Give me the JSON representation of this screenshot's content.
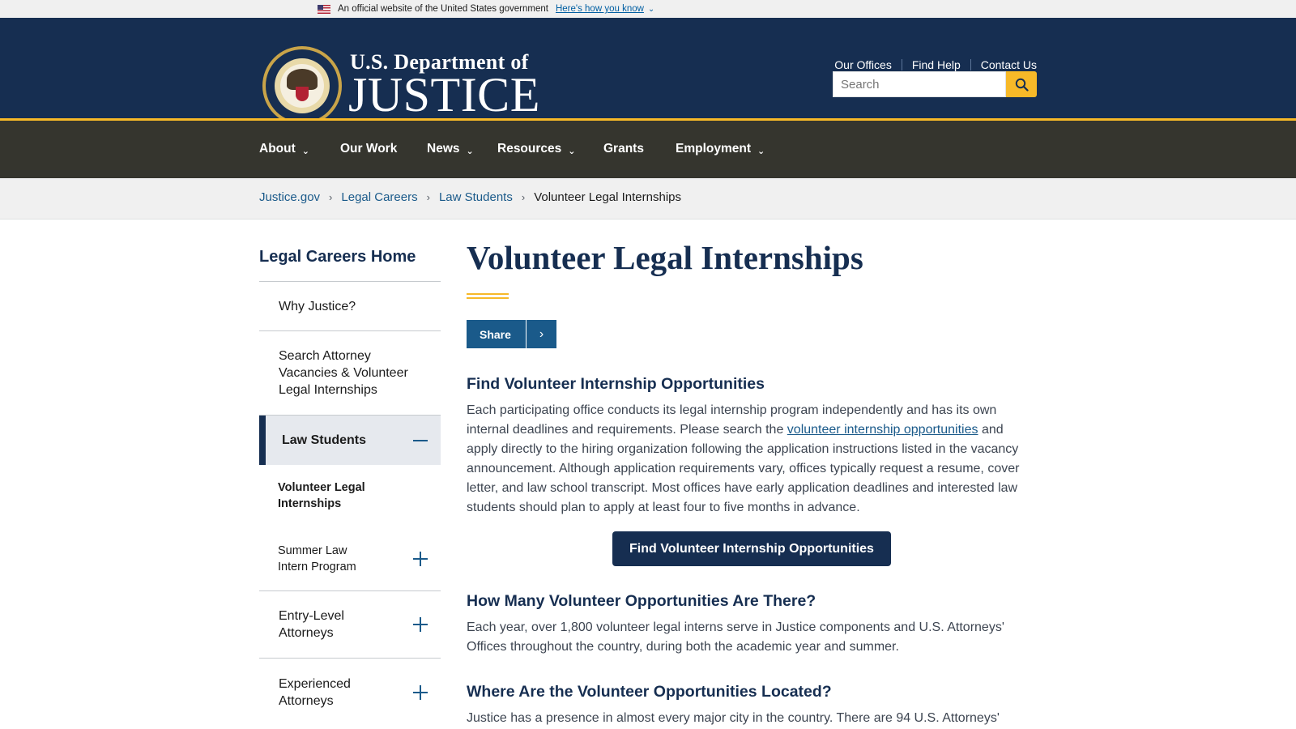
{
  "gov_banner": {
    "text": "An official website of the United States government",
    "link": "Here's how you know"
  },
  "header": {
    "logo_top": "U.S. Department of",
    "logo_main": "JUSTICE",
    "utility_nav": [
      "Our Offices",
      "Find Help",
      "Contact Us"
    ],
    "search_placeholder": "Search"
  },
  "main_nav": [
    {
      "label": "About",
      "has_dropdown": true
    },
    {
      "label": "Our Work",
      "has_dropdown": false
    },
    {
      "label": "News",
      "has_dropdown": true
    },
    {
      "label": "Resources",
      "has_dropdown": true
    },
    {
      "label": "Grants",
      "has_dropdown": false
    },
    {
      "label": "Employment",
      "has_dropdown": true
    }
  ],
  "breadcrumb": {
    "links": [
      "Justice.gov",
      "Legal Careers",
      "Law Students"
    ],
    "current": "Volunteer Legal Internships"
  },
  "sidebar": {
    "title": "Legal Careers Home",
    "items": [
      "Why Justice?",
      "Search Attorney Vacancies & Volunteer Legal Internships",
      "Law Students",
      "Entry-Level Attorneys",
      "Experienced Attorneys"
    ],
    "sub_items": [
      "Volunteer Legal Internships",
      "Summer Law Intern Program"
    ]
  },
  "content": {
    "title": "Volunteer Legal Internships",
    "share_label": "Share",
    "section1": {
      "heading": "Find Volunteer Internship Opportunities",
      "text_before_link": "Each participating office conducts its legal internship program independently and has its own internal deadlines and requirements. Please search the ",
      "link_text": "volunteer internship opportunities",
      "text_after_link": " and apply directly to the hiring organization following the application instructions listed in the vacancy announcement. Although application requirements vary, offices typically request a resume, cover letter, and law school transcript. Most offices have early application deadlines and interested law students should plan to apply at least four to five months in advance.",
      "button": "Find Volunteer Internship Opportunities"
    },
    "section2": {
      "heading": "How Many Volunteer Opportunities Are There?",
      "text": "Each year, over 1,800 volunteer legal interns serve in Justice components and U.S. Attorneys' Offices throughout the country, during both the academic year and summer."
    },
    "section3": {
      "heading": "Where Are the Volunteer Opportunities Located?",
      "text": "Justice has a presence in almost every major city in the country. There are 94 U.S. Attorneys'"
    }
  },
  "colors": {
    "navy": "#162e51",
    "gold": "#f7b928",
    "nav_bg": "#35352e",
    "link": "#1a5a8a"
  },
  "icons": {
    "flag": "us-flag-icon",
    "search": "search-icon",
    "chevron": "chevron-down-icon",
    "share_arrow": "chevron-right-icon"
  }
}
